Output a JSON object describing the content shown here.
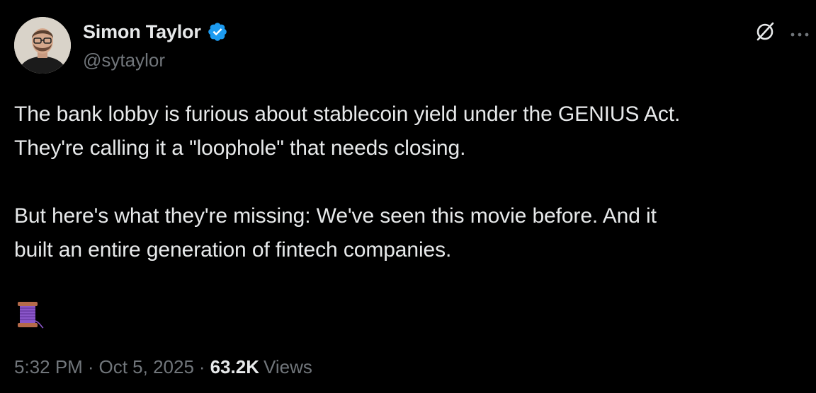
{
  "author": {
    "display_name": "Simon Taylor",
    "handle": "@sytaylor",
    "verified": true,
    "verified_color": "#1d9bf0"
  },
  "tweet": {
    "lines_para1": [
      "The bank lobby is furious about stablecoin yield under the GENIUS Act.",
      "They're calling it a \"loophole\" that needs closing."
    ],
    "lines_para2": [
      "But here's what they're missing: We've seen this movie before. And it",
      "built an entire generation of fintech companies."
    ],
    "thread_emoji": "spool-of-thread"
  },
  "meta": {
    "time": "5:32 PM",
    "separator": "·",
    "date": "Oct 5, 2025",
    "views_count": "63.2K",
    "views_label": "Views"
  },
  "icons": {
    "top_right_1": "grok-icon",
    "top_right_2": "more-icon"
  },
  "colors": {
    "background": "#000000",
    "text_primary": "#e7e9ea",
    "text_secondary": "#71767b"
  }
}
